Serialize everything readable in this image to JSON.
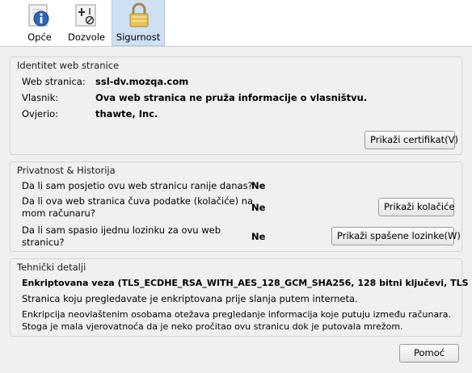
{
  "tabs": [
    {
      "label": "Opće",
      "icon": "info-icon"
    },
    {
      "label": "Dozvole",
      "icon": "permissions-icon"
    },
    {
      "label": "Sigurnost",
      "icon": "lock-icon",
      "active": true
    }
  ],
  "identity": {
    "title": "Identitet web stranice",
    "rows": [
      {
        "label": "Web stranica:",
        "value": "ssl-dv.mozqa.com"
      },
      {
        "label": "Vlasnik:",
        "value": "Ova web stranica ne pruža informacije o vlasništvu."
      },
      {
        "label": "Ovjerio:",
        "value": "thawte, Inc."
      }
    ],
    "button": "Prikaži certifikat(V)"
  },
  "privacy": {
    "title": "Privatnost & Historija",
    "q1": {
      "text": "Da li sam posjetio ovu web stranicu ranije danas?",
      "answer": "Ne"
    },
    "q2": {
      "line1": "Da li ova web stranica čuva podatke (kolačiće) na",
      "line2": "mom računaru?",
      "answer": "Ne",
      "button": "Prikaži kolačiće"
    },
    "q3": {
      "line1": "Da li sam spasio ijednu lozinku za ovu web",
      "line2": "stranicu?",
      "answer": "Ne",
      "button": "Prikaži spašene lozinke(W)"
    }
  },
  "technical": {
    "title": "Tehnički detalji",
    "headline": "Enkriptovana veza (TLS_ECDHE_RSA_WITH_AES_128_GCM_SHA256, 128 bitni ključevi, TLS 1.2)",
    "line1": "Stranica koju pregledavate je enkriptovana prije slanja putem interneta.",
    "line2": "Enkripcija neovlaštenim osobama otežava pregledanje informacija koje putuju između računara.",
    "line3": "Stoga je mala vjerovatnoća da je neko pročitao ovu stranicu dok je putovala mrežom."
  },
  "footer": {
    "help_button": "Pomoć"
  },
  "colors": {
    "active_tab": "#cfe0f3",
    "background": "#f0f0f0"
  }
}
